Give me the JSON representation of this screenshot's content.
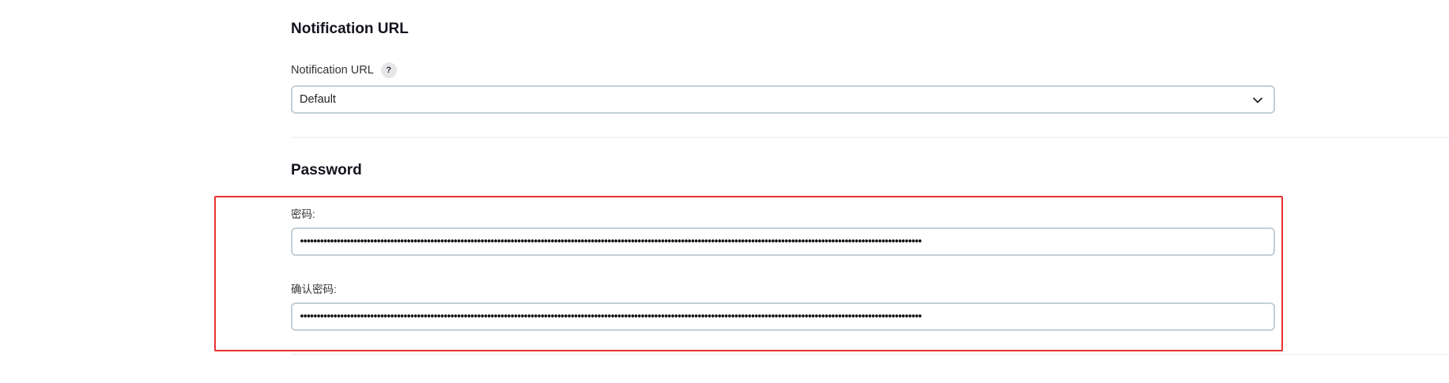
{
  "notification_section": {
    "title": "Notification URL",
    "field_label": "Notification URL",
    "help_glyph": "?",
    "select_value": "Default"
  },
  "password_section": {
    "title": "Password",
    "password_label": "密码:",
    "password_value": "••••••••••••••••••••••••••••••••••••••••••••••••••••••••••••••••••••••••••••••••••••••••••••••••••••••••••••••••••••••••••••••••••••••••••••••••••••••••••••••••••••••••••••••••••••••••••",
    "confirm_label": "确认密码:",
    "confirm_value": "••••••••••••••••••••••••••••••••••••••••••••••••••••••••••••••••••••••••••••••••••••••••••••••••••••••••••••••••••••••••••••••••••••••••••••••••••••••••••••••••••••••••••••••••••••••••••"
  },
  "annotation": {
    "highlight_color": "#e8322f"
  }
}
